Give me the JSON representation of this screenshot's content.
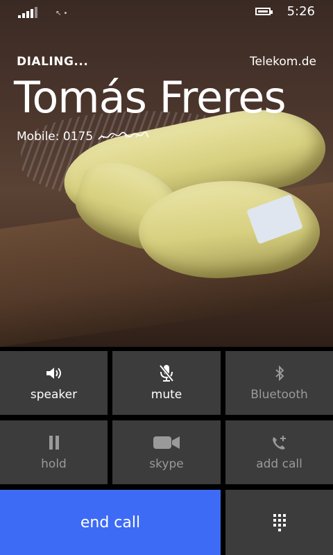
{
  "status_bar": {
    "time": "5:26",
    "signal_icon": "cell-signal-icon",
    "battery_icon": "battery-icon",
    "battery_level": 0.8
  },
  "call": {
    "state": "DIALING...",
    "carrier": "Telekom.de",
    "contact_name": "Tomás Freres",
    "number_label": "Mobile: 0175"
  },
  "buttons": {
    "speaker": {
      "label": "speaker",
      "icon": "speaker-icon"
    },
    "mute": {
      "label": "mute",
      "icon": "microphone-muted-icon"
    },
    "bluetooth": {
      "label": "Bluetooth",
      "icon": "bluetooth-icon"
    },
    "hold": {
      "label": "hold",
      "icon": "pause-icon"
    },
    "skype": {
      "label": "skype",
      "icon": "video-camera-icon"
    },
    "add_call": {
      "label": "add call",
      "icon": "phone-plus-icon"
    },
    "end_call": {
      "label": "end call"
    },
    "keypad": {
      "icon": "keypad-icon"
    }
  },
  "colors": {
    "end_call": "#3d6bf5",
    "tile": "#3c3c3c",
    "disabled_text": "#9a9a9a"
  }
}
